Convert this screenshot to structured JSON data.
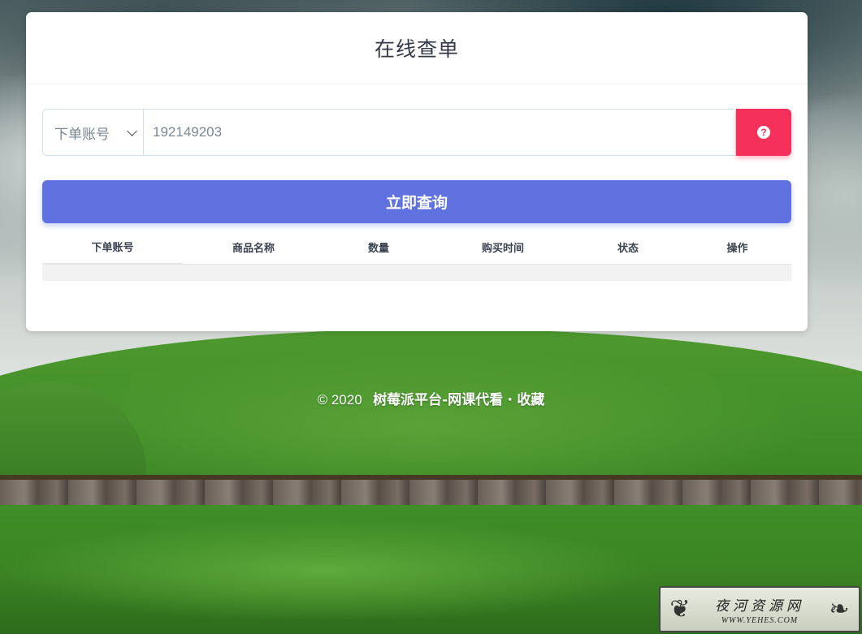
{
  "page": {
    "title": "在线查单"
  },
  "search": {
    "select_value": "下单账号",
    "input_value": "192149203",
    "help_icon": "question-circle-icon",
    "help_glyph": "?"
  },
  "query_button": {
    "label": "立即查询"
  },
  "table": {
    "columns": [
      "下单账号",
      "商品名称",
      "数量",
      "购买时间",
      "状态",
      "操作"
    ],
    "rows": []
  },
  "footer": {
    "copyright": "© 2020",
    "site_name": "树莓派平台-网课代看",
    "separator": "·",
    "favorite": "收藏"
  },
  "watermark": {
    "cn": "夜河资源网",
    "en": "WWW.YEHES.COM"
  },
  "colors": {
    "primary": "#5f72e0",
    "help_button": "#f5305a"
  }
}
